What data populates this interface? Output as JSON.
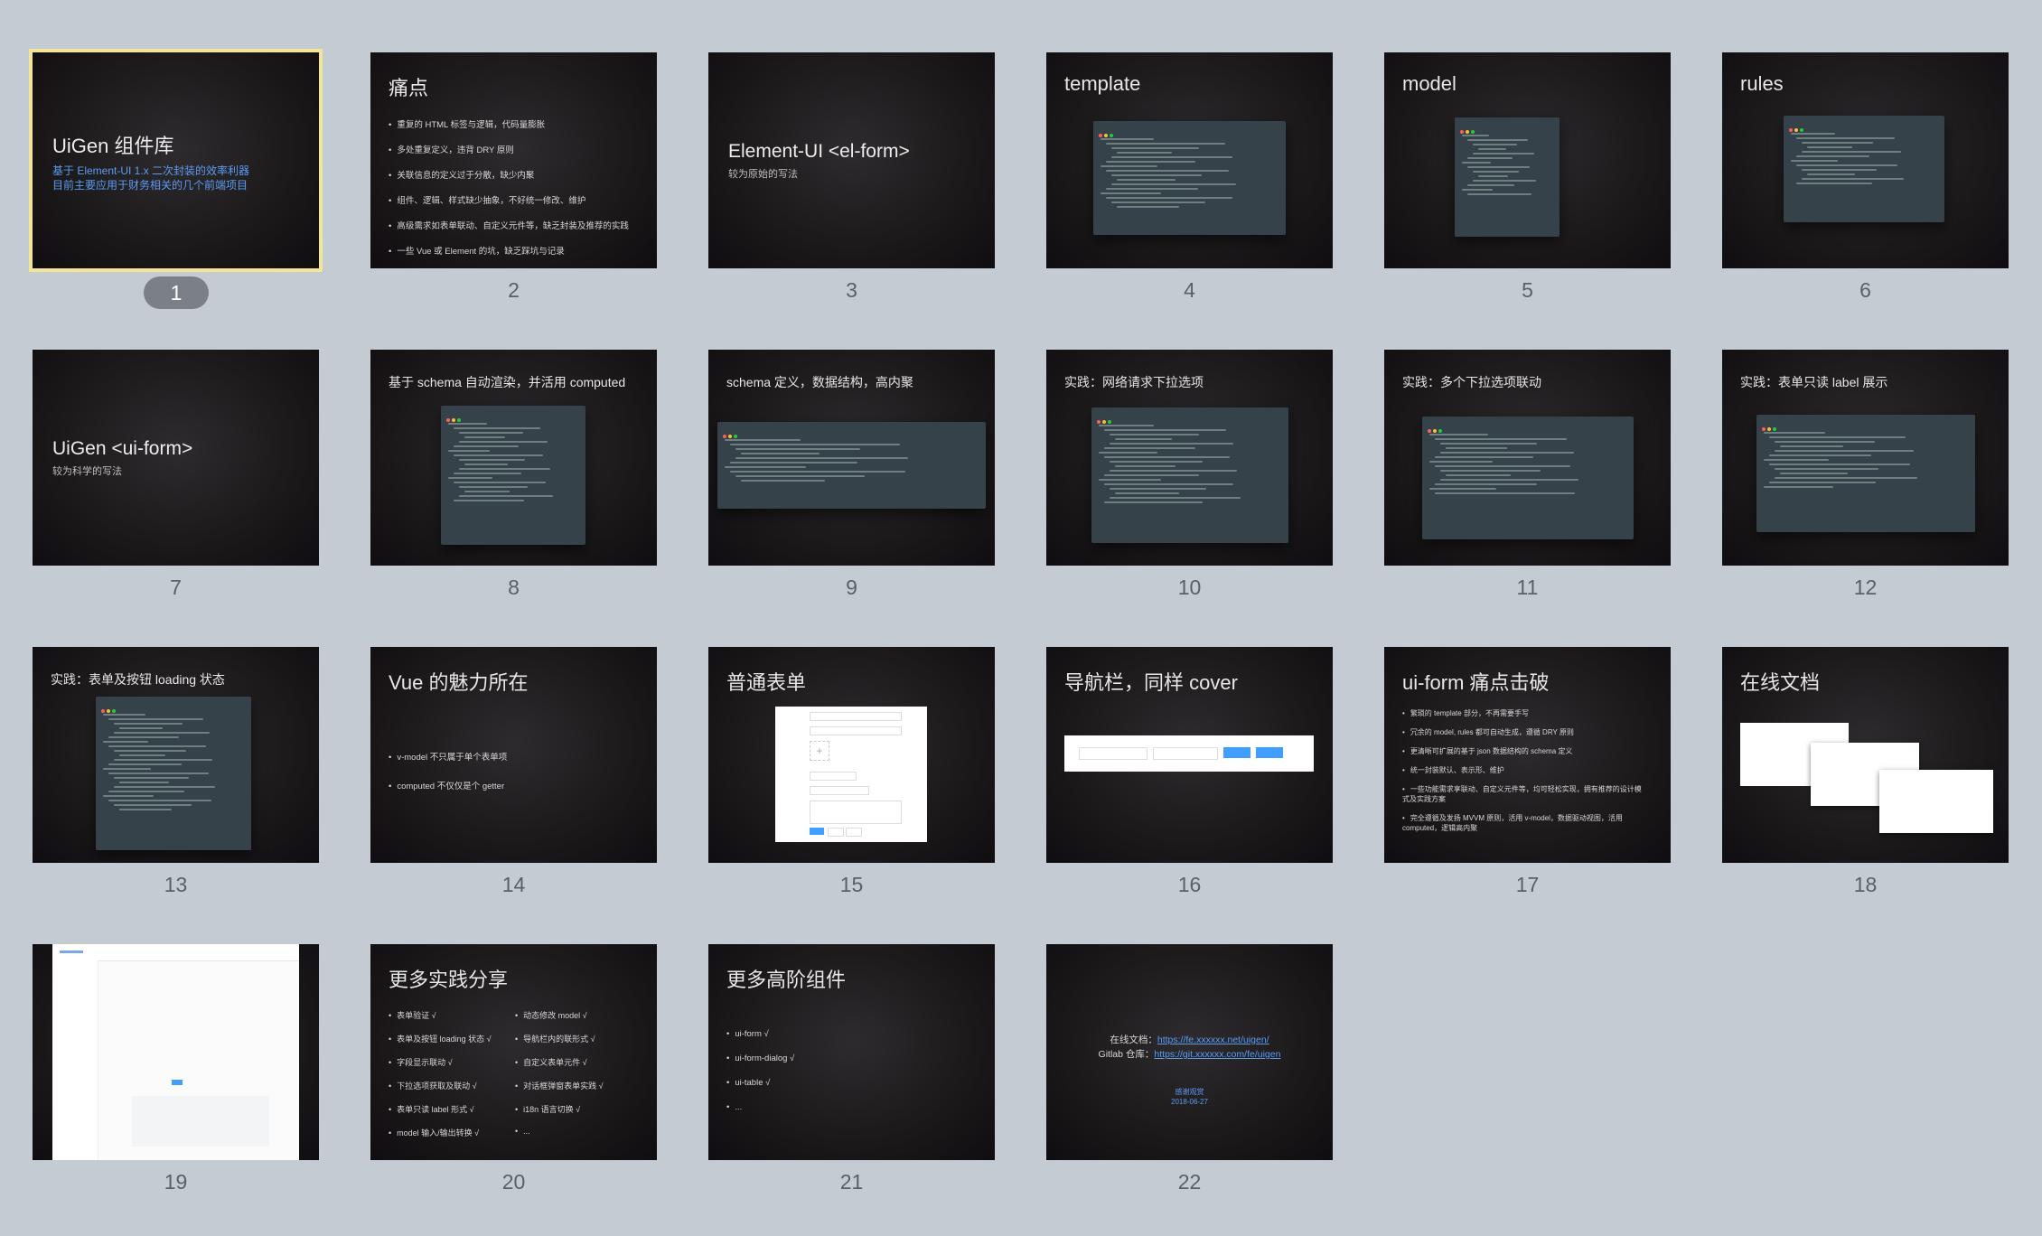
{
  "selected_slide": 1,
  "slides": {
    "s1": {
      "number": "1",
      "title": "UiGen 组件库",
      "line1": "基于 Element-UI 1.x 二次封装的效率利器",
      "line2": "目前主要应用于财务相关的几个前端项目"
    },
    "s2": {
      "number": "2",
      "title": "痛点",
      "bullets": [
        "重复的 HTML 标签与逻辑，代码量膨胀",
        "多处重复定义，违背 DRY 原则",
        "关联信息的定义过于分散，缺少内聚",
        "组件、逻辑、样式缺少抽象，不好统一修改、维护",
        "高级需求如表单联动、自定义元件等，缺乏封装及推荐的实践",
        "一些 Vue 或 Element 的坑，缺乏踩坑与记录"
      ]
    },
    "s3": {
      "number": "3",
      "title": "Element-UI <el-form>",
      "sub": "较为原始的写法"
    },
    "s4": {
      "number": "4",
      "title": "template"
    },
    "s5": {
      "number": "5",
      "title": "model"
    },
    "s6": {
      "number": "6",
      "title": "rules"
    },
    "s7": {
      "number": "7",
      "title": "UiGen <ui-form>",
      "sub": "较为科学的写法"
    },
    "s8": {
      "number": "8",
      "title": "基于 schema 自动渲染，并活用 computed"
    },
    "s9": {
      "number": "9",
      "title": "schema 定义，数据结构，高内聚"
    },
    "s10": {
      "number": "10",
      "title": "实践：网络请求下拉选项"
    },
    "s11": {
      "number": "11",
      "title": "实践：多个下拉选项联动"
    },
    "s12": {
      "number": "12",
      "title": "实践：表单只读 label 展示"
    },
    "s13": {
      "number": "13",
      "title": "实践：表单及按钮 loading 状态"
    },
    "s14": {
      "number": "14",
      "title": "Vue 的魅力所在",
      "bullets": [
        "v-model 不只属于单个表单项",
        "computed 不仅仅是个 getter"
      ]
    },
    "s15": {
      "number": "15",
      "title": "普通表单"
    },
    "s16": {
      "number": "16",
      "title": "导航栏，同样 cover"
    },
    "s17": {
      "number": "17",
      "title": "ui-form 痛点击破",
      "bullets": [
        "繁琐的 template 部分，不再需要手写",
        "冗余的 model, rules 都可自动生成，遵循 DRY 原则",
        "更清晰可扩展的基于 json 数据结构的 schema 定义",
        "统一封装默认、表示形、维护",
        "一些功能需求享联动、自定义元件等，均可轻松实现，拥有推荐的设计模式及实践方案",
        "完全遵循及发扬 MVVM 原则，活用 v-model，数据驱动视图，活用 computed，逻辑高内聚"
      ]
    },
    "s18": {
      "number": "18",
      "title": "在线文档"
    },
    "s19": {
      "number": "19"
    },
    "s20": {
      "number": "20",
      "title": "更多实践分享",
      "col1": [
        "表单验证 √",
        "表单及按钮 loading 状态 √",
        "字段显示联动 √",
        "下拉选项获取及联动 √",
        "表单只读 label 形式 √",
        "model 输入/输出转换 √"
      ],
      "col2": [
        "动态修改 model √",
        "导航栏内的联形式 √",
        "自定义表单元件 √",
        "对话框弹窗表单实践 √",
        "i18n 语言切换 √",
        "..."
      ]
    },
    "s21": {
      "number": "21",
      "title": "更多高阶组件",
      "bullets": [
        "ui-form √",
        "ui-form-dialog √",
        "ui-table √",
        "..."
      ]
    },
    "s22": {
      "number": "22",
      "doc_label": "在线文档：",
      "doc_url": "https://fe.xxxxxx.net/uigen/",
      "git_label": "Gitlab 仓库：",
      "git_url": "https://git.xxxxxx.com/fe/uigen",
      "thanks": "感谢观赏",
      "date": "2018-06-27"
    }
  }
}
